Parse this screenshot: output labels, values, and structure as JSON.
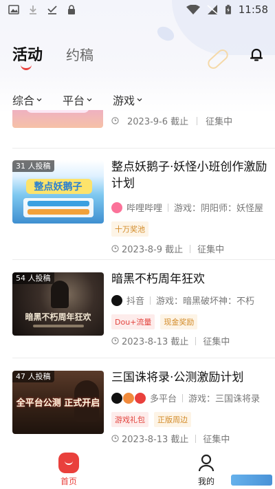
{
  "status_bar": {
    "time": "11:58"
  },
  "header": {
    "tabs": [
      {
        "label": "活动",
        "active": true
      },
      {
        "label": "约稿",
        "active": false
      }
    ]
  },
  "filters": [
    {
      "label": "综合"
    },
    {
      "label": "平台"
    },
    {
      "label": "游戏"
    }
  ],
  "partial_item": {
    "deadline": "2023-9-6 截止",
    "status": "征集中"
  },
  "items": [
    {
      "submissions": "31 人投稿",
      "title": "整点妖鹅子·妖怪小班创作激励计划",
      "thumb_caption": "整点妖鹅子",
      "platform": "哔哩哔哩",
      "game": "游戏：阴阳师：妖怪屋",
      "tags": [
        {
          "label": "十万奖池",
          "style": "orange"
        }
      ],
      "deadline": "2023-8-9 截止",
      "status": "征集中"
    },
    {
      "submissions": "54 人投稿",
      "title": "暗黑不朽周年狂欢",
      "thumb_caption": "暗黑不朽周年狂欢",
      "platform": "抖音",
      "game": "游戏：暗黑破坏神：不朽",
      "tags": [
        {
          "label": "Dou+流量",
          "style": "red"
        },
        {
          "label": "现金奖励",
          "style": "orange"
        }
      ],
      "deadline": "2023-8-13 截止",
      "status": "征集中"
    },
    {
      "submissions": "47 人投稿",
      "title": "三国诛将录·公测激励计划",
      "thumb_caption": "全平台公测 正式开启",
      "platform": "多平台",
      "game": "游戏：三国诛将录",
      "tags": [
        {
          "label": "游戏礼包",
          "style": "red"
        },
        {
          "label": "正版周边",
          "style": "orange"
        }
      ],
      "deadline": "2023-8-13 截止",
      "status": "征集中"
    }
  ],
  "bottom_nav": [
    {
      "label": "首页",
      "active": true
    },
    {
      "label": "我的",
      "active": false
    }
  ],
  "colors": {
    "accent": "#e9403c",
    "tag_orange": "#d28a27",
    "tag_red": "#e2433d"
  }
}
